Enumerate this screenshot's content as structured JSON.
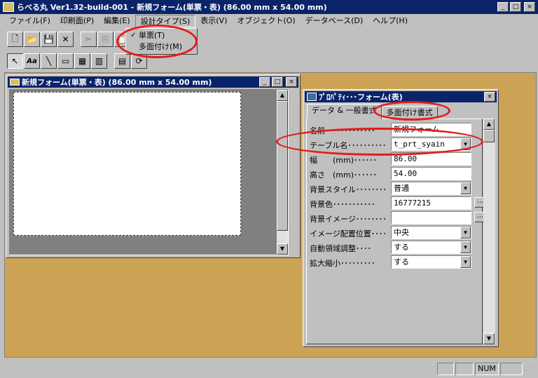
{
  "window": {
    "title": "らべる丸 Ver1.32-build-001 - 新規フォーム(単票・表) (86.00 mm x 54.00 mm)",
    "min_label": "_",
    "max_label": "□",
    "close_label": "×"
  },
  "menu": {
    "items": [
      {
        "label": "ファイル(F)"
      },
      {
        "label": "印刷面(P)"
      },
      {
        "label": "編集(E)"
      },
      {
        "label": "設計タイプ(S)"
      },
      {
        "label": "表示(V)"
      },
      {
        "label": "オブジェクト(O)"
      },
      {
        "label": "データベース(D)"
      },
      {
        "label": "ヘルプ(H)"
      }
    ],
    "dropdown": {
      "items": [
        {
          "label": "単票(T)",
          "check": "✓"
        },
        {
          "label": "多面付け(M)",
          "check": ""
        }
      ]
    }
  },
  "toolbar1": {
    "icons": [
      "🗋",
      "📂",
      "💾",
      "✕",
      "✂",
      "⎘",
      "📋"
    ]
  },
  "toolbar2": {
    "icons": [
      "↖",
      "Aa",
      "╲",
      "▭",
      "▦",
      "▥",
      "▤",
      "⟳"
    ]
  },
  "child_window": {
    "title": "新規フォーム(単票・表) (86.00 mm x 54.00 mm)"
  },
  "property_dialog": {
    "title": "ﾌﾟﾛﾊﾟﾃｨ･･･フォーム(表)",
    "tabs": [
      {
        "label": "データ & 一般書式"
      },
      {
        "label": "多面付け書式"
      }
    ],
    "rows": [
      {
        "label": "名前･････････････",
        "value": "新規フォーム"
      },
      {
        "label": "テーブル名･･････････",
        "value": "t_prt_syain"
      },
      {
        "label": "幅　　(mm)･･････",
        "value": "86.00"
      },
      {
        "label": "高さ　(mm)･･････",
        "value": "54.00"
      },
      {
        "label": "背景スタイル････････",
        "value": "普通"
      },
      {
        "label": "背景色･･･････････",
        "value": "16777215"
      },
      {
        "label": "背景イメージ････････",
        "value": ""
      },
      {
        "label": "イメージ配置位置････",
        "value": "中央"
      },
      {
        "label": "自動領域調整････",
        "value": "する"
      },
      {
        "label": "拡大縮小･････････",
        "value": "する"
      }
    ],
    "ellipsis_label": "…"
  },
  "statusbar": {
    "num": "NUM"
  },
  "colors": {
    "title_bar": "#0a246a",
    "workspace": "#cca354",
    "annotation": "#e41b1b"
  }
}
